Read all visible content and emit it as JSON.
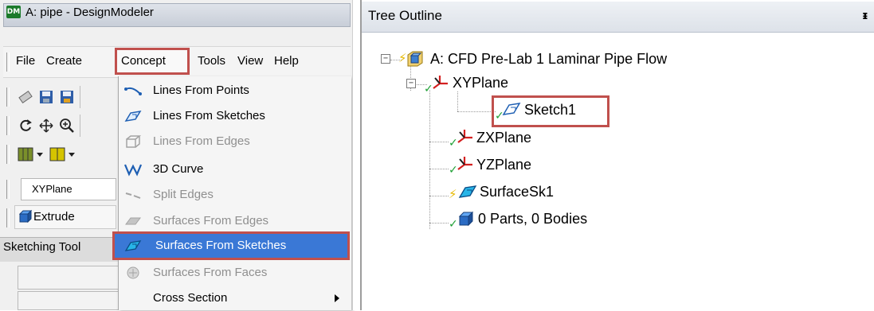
{
  "window": {
    "logo": "DM",
    "title": "A: pipe - DesignModeler"
  },
  "menubar": {
    "items": [
      "File",
      "Create",
      "Concept",
      "Tools",
      "View",
      "Help"
    ]
  },
  "toolbar": {
    "plane_select": "XYPlane",
    "extrude_label": "Extrude"
  },
  "sketching": {
    "label": "Sketching Tool"
  },
  "concept_menu": {
    "items": [
      {
        "label": "Lines From Points",
        "enabled": true
      },
      {
        "label": "Lines From Sketches",
        "enabled": true
      },
      {
        "label": "Lines From Edges",
        "enabled": false
      },
      {
        "label": "3D Curve",
        "enabled": true
      },
      {
        "label": "Split Edges",
        "enabled": false
      },
      {
        "label": "Surfaces From Edges",
        "enabled": false
      },
      {
        "label": "Surfaces From Sketches",
        "enabled": true,
        "highlighted": true
      },
      {
        "label": "Surfaces From Faces",
        "enabled": false
      },
      {
        "label": "Cross Section",
        "enabled": true,
        "submenu": true
      }
    ]
  },
  "tree": {
    "title": "Tree Outline",
    "pin": "ᵻ",
    "nodes": [
      {
        "label": "A: CFD Pre-Lab 1 Laminar Pipe Flow",
        "icon": "model-icon"
      },
      {
        "label": "XYPlane",
        "icon": "plane-axes-icon"
      },
      {
        "label": "Sketch1",
        "icon": "sketch-icon",
        "highlighted": true
      },
      {
        "label": "ZXPlane",
        "icon": "plane-axes-icon"
      },
      {
        "label": "YZPlane",
        "icon": "plane-axes-icon"
      },
      {
        "label": "SurfaceSk1",
        "icon": "surface-sketch-icon"
      },
      {
        "label": "0 Parts, 0 Bodies",
        "icon": "parts-icon"
      }
    ]
  },
  "colors": {
    "highlight_border": "#c0504d",
    "selection": "#3a78d6",
    "check_green": "#1fa035"
  }
}
